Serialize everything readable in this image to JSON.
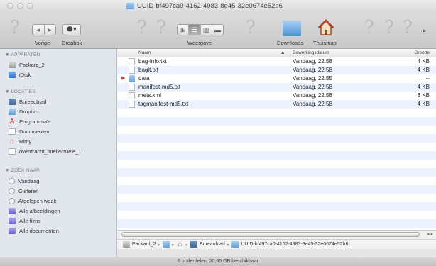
{
  "window": {
    "title": "UUID-bf497ca0-4162-4983-8e45-32e0674e52b6"
  },
  "toolbar": {
    "back_label": "Vorige",
    "back_glyph": "◂",
    "forward_glyph": "▸",
    "dropbox_label": "Dropbox",
    "view_label": "Weergave",
    "downloads_label": "Downloads",
    "home_label": "Thuismap",
    "placeholder_glyph": "?",
    "close_glyph": "x"
  },
  "sidebar": {
    "sections": [
      {
        "title": "▼ APPARATEN"
      },
      {
        "title": "▼ LOCATIES"
      },
      {
        "title": "▼ ZOEK NAAR"
      }
    ],
    "devices": [
      {
        "label": "Packard_2",
        "icon": "disk-icon"
      },
      {
        "label": "iDisk",
        "icon": "idisk-icon"
      }
    ],
    "places": [
      {
        "label": "Bureaublad",
        "icon": "desktop-icon"
      },
      {
        "label": "Dropbox",
        "icon": "folder-icon"
      },
      {
        "label": "Programma's",
        "icon": "apps-icon"
      },
      {
        "label": "Documenten",
        "icon": "documents-icon"
      },
      {
        "label": "Rimy",
        "icon": "home-icon"
      },
      {
        "label": "overdracht_intellectuele_...",
        "icon": "document-icon"
      }
    ],
    "search": [
      {
        "label": "Vandaag",
        "icon": "clock-icon"
      },
      {
        "label": "Gisteren",
        "icon": "clock-icon"
      },
      {
        "label": "Afgelopen week",
        "icon": "clock-icon"
      },
      {
        "label": "Alle afbeeldingen",
        "icon": "purple-folder-icon"
      },
      {
        "label": "Alle films",
        "icon": "purple-folder-icon"
      },
      {
        "label": "Alle documenten",
        "icon": "purple-folder-icon"
      }
    ]
  },
  "list": {
    "columns": {
      "name": "Naam",
      "sort": "▲",
      "date": "Bewerkingsdatum",
      "size": "Grootte"
    },
    "rows": [
      {
        "name": "bag-info.txt",
        "date": "Vandaag, 22:58",
        "size": "4 KB",
        "type": "txt",
        "expand": ""
      },
      {
        "name": "bagit.txt",
        "date": "Vandaag, 22:58",
        "size": "4 KB",
        "type": "txt",
        "expand": ""
      },
      {
        "name": "data",
        "date": "Vandaag, 22:55",
        "size": "--",
        "type": "folder",
        "expand": "▶"
      },
      {
        "name": "manifest-md5.txt",
        "date": "Vandaag, 22:58",
        "size": "4 KB",
        "type": "txt",
        "expand": ""
      },
      {
        "name": "mets.xml",
        "date": "Vandaag, 22:58",
        "size": "8 KB",
        "type": "txt",
        "expand": ""
      },
      {
        "name": "tagmanifest-md5.txt",
        "date": "Vandaag, 22:58",
        "size": "4 KB",
        "type": "txt",
        "expand": ""
      }
    ]
  },
  "scrollbar": {
    "buttons": "◂ ▸"
  },
  "pathbar": {
    "items": [
      "Packard_2",
      "",
      "",
      "Bureaublad",
      "UUID-bf497ca0-4162-4983-8e45-32e0674e52b6"
    ],
    "separator": "▸"
  },
  "status": {
    "text": "6 onderdelen, 20,65 GB beschikbaar"
  }
}
